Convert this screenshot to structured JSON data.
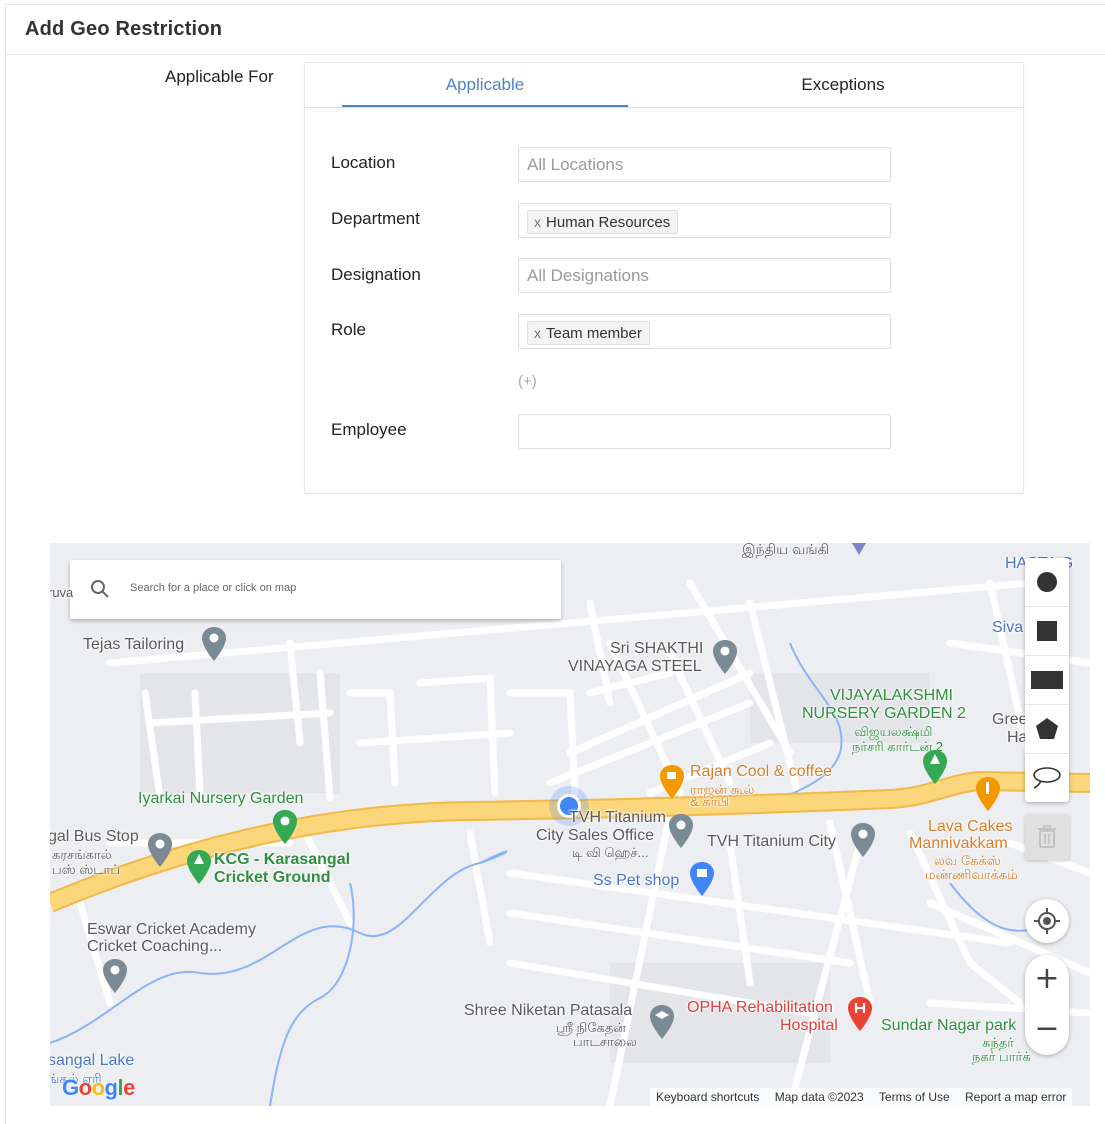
{
  "header": {
    "title": "Add Geo Restriction"
  },
  "applicable_for_label": "Applicable For",
  "tabs": [
    {
      "label": "Applicable",
      "active": true
    },
    {
      "label": "Exceptions",
      "active": false
    }
  ],
  "form": {
    "location": {
      "label": "Location",
      "placeholder": "All Locations"
    },
    "department": {
      "label": "Department",
      "chip": "Human Resources",
      "chip_remove": "x"
    },
    "designation": {
      "label": "Designation",
      "placeholder": "All Designations"
    },
    "role": {
      "label": "Role",
      "chip": "Team member",
      "chip_remove": "x"
    },
    "add_more": "(+)",
    "employee": {
      "label": "Employee",
      "value": ""
    }
  },
  "map": {
    "search_placeholder": "Search for a place or click on map",
    "labels": {
      "bank": "இந்திய வங்கி",
      "hasta": "HASTA G",
      "ruva": "ruva",
      "tejas": "Tejas Tailoring",
      "shakthi1": "Sri SHAKTHI",
      "shakthi2": "VINAYAGA STEEL",
      "siva": "Siva",
      "vijaya1": "VIJAYALAKSHMI",
      "vijaya2": "NURSERY GARDEN 2",
      "vijaya3": "விஜயலக்ஷ்மி",
      "vijaya4": "நர்சரி கார்டன் 2",
      "green1": "Green",
      "green2": "Ha",
      "rajan1": "Rajan Cool & coffee",
      "rajan2": "ராஜன் கூல்",
      "rajan3": "& காபி",
      "iyarkai": "Iyarkai Nursery Garden",
      "tvh1": "TVH Titanium",
      "tvh2": "City Sales Office",
      "tvh3": "டி வி ஹெச்...",
      "tvhcity": "TVH Titanium City",
      "lava1": "Lava Cakes",
      "lava2": "Mannivakkam",
      "lava3": "லவ கேக்ஸ்",
      "lava4": "மண்ணிவாக்கம்",
      "bus1": "gal Bus Stop",
      "bus2": "கரசங்கால்",
      "bus3": "பஸ் ஸ்டாப்",
      "kcg1": "KCG - Karasangal",
      "kcg2": "Cricket Ground",
      "pet": "Ss Pet shop",
      "eswar1": "Eswar Cricket Academy",
      "eswar2": "Cricket Coaching...",
      "shree1": "Shree Niketan Patasala",
      "shree2": "ஸ்ரீ நிகேதன்",
      "shree3": "பாடசாலை",
      "opha1": "OPHA Rehabilitation",
      "opha2": "Hospital",
      "sundar1": "Sundar Nagar park",
      "sundar2": "சுந்தர்",
      "sundar3": "நகர் பார்க்",
      "lake1": "sangal Lake",
      "lake2": "ங்கல் ஏரி"
    },
    "google_logo": [
      "G",
      "o",
      "o",
      "g",
      "l",
      "e"
    ],
    "footer": {
      "shortcuts": "Keyboard shortcuts",
      "data": "Map data ©2023",
      "terms": "Terms of Use",
      "report": "Report a map error"
    },
    "zoom_in": "+",
    "zoom_out": "−",
    "colors": {
      "road_major": "#fbd67a",
      "road_major_edge": "#f0b94a",
      "road_minor": "#ffffff",
      "water": "#8ab4f8",
      "accent": "#4a86c6"
    }
  }
}
